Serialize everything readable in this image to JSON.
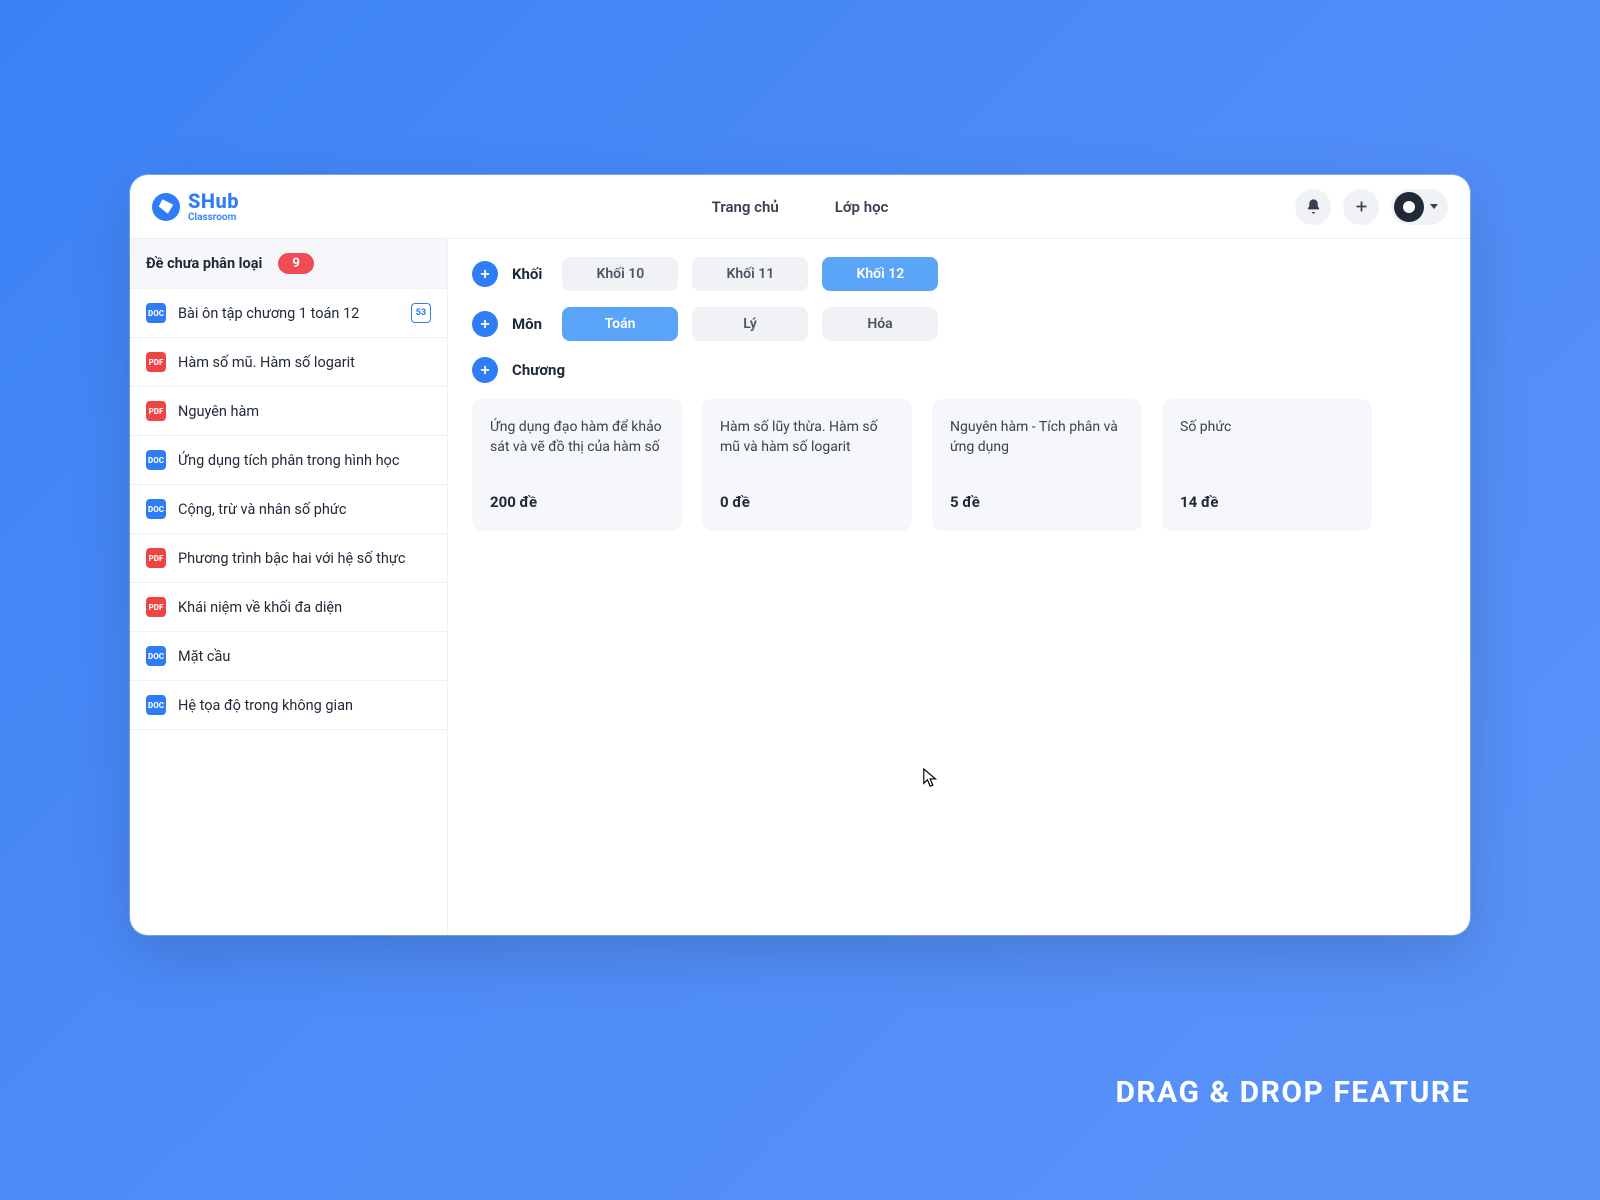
{
  "brand": {
    "name": "SHub",
    "sub": "Classroom"
  },
  "nav": {
    "home": "Trang chủ",
    "class": "Lớp học"
  },
  "sidebar": {
    "header": {
      "label": "Đề chưa phân loại",
      "badge": "9"
    },
    "items": [
      {
        "icon": "doc",
        "label": "Bài ôn tập chương 1 toán 12",
        "trail": "53"
      },
      {
        "icon": "pdf",
        "label": "Hàm số mũ. Hàm số logarit"
      },
      {
        "icon": "pdf",
        "label": "Nguyên hàm"
      },
      {
        "icon": "doc",
        "label": "Ứng dụng tích phân trong hình học"
      },
      {
        "icon": "doc",
        "label": "Cộng, trừ và nhân số phức"
      },
      {
        "icon": "pdf",
        "label": "Phương trình bậc hai với hệ số thực"
      },
      {
        "icon": "pdf",
        "label": "Khái niệm về khối đa diện"
      },
      {
        "icon": "doc",
        "label": "Mặt cầu"
      },
      {
        "icon": "doc",
        "label": "Hệ tọa độ trong không gian"
      }
    ]
  },
  "filters": {
    "grade": {
      "label": "Khối",
      "options": [
        "Khối 10",
        "Khối 11",
        "Khối 12"
      ],
      "active": 2
    },
    "subject": {
      "label": "Môn",
      "options": [
        "Toán",
        "Lý",
        "Hóa"
      ],
      "active": 0
    },
    "chapter": {
      "label": "Chương"
    }
  },
  "cards": [
    {
      "title": "Ứng dụng đạo hàm để khảo sát và vẽ đồ thị của hàm số",
      "count": "200 đề"
    },
    {
      "title": "Hàm số lũy thừa. Hàm số mũ và hàm số logarit",
      "count": "0 đề"
    },
    {
      "title": "Nguyên hàm - Tích phân và ứng dụng",
      "count": "5 đề"
    },
    {
      "title": "Số phức",
      "count": "14 đề"
    }
  ],
  "caption": "DRAG & DROP FEATURE"
}
